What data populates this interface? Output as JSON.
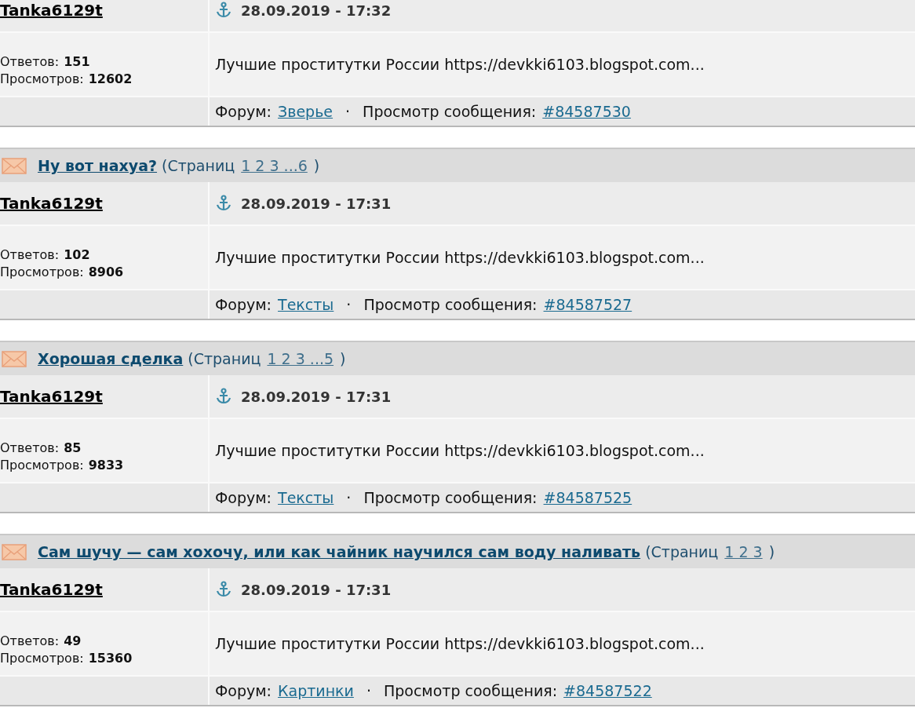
{
  "posts": [
    {
      "author": "Tanka6129t",
      "date": "28.09.2019 - 17:32",
      "replies_label": "Ответов:",
      "replies": "151",
      "views_label": "Просмотров:",
      "views": "12602",
      "text": "Лучшие проститутки России https://devkki6103.blogspot.com...",
      "forum_label": "Форум:",
      "forum": "Зверье",
      "separator": "·",
      "message_label": "Просмотр сообщения:",
      "message_id": "#84587530"
    },
    {
      "title": "Ну вот нахуа?",
      "pages_prefix": "(Страниц",
      "pages": "1 2 3 ...6",
      "pages_suffix": ")",
      "author": "Tanka6129t",
      "date": "28.09.2019 - 17:31",
      "replies_label": "Ответов:",
      "replies": "102",
      "views_label": "Просмотров:",
      "views": "8906",
      "text": "Лучшие проститутки России https://devkki6103.blogspot.com...",
      "forum_label": "Форум:",
      "forum": "Тексты",
      "separator": "·",
      "message_label": "Просмотр сообщения:",
      "message_id": "#84587527"
    },
    {
      "title": "Хорошая сделка",
      "pages_prefix": "(Страниц",
      "pages": "1 2 3 ...5",
      "pages_suffix": ")",
      "author": "Tanka6129t",
      "date": "28.09.2019 - 17:31",
      "replies_label": "Ответов:",
      "replies": "85",
      "views_label": "Просмотров:",
      "views": "9833",
      "text": "Лучшие проститутки России https://devkki6103.blogspot.com...",
      "forum_label": "Форум:",
      "forum": "Тексты",
      "separator": "·",
      "message_label": "Просмотр сообщения:",
      "message_id": "#84587525"
    },
    {
      "title": "Сам шучу — сам хохочу, или как чайник научился сам воду наливать",
      "pages_prefix": "(Страниц",
      "pages": "1 2 3",
      "pages_suffix": ")",
      "author": "Tanka6129t",
      "date": "28.09.2019 - 17:31",
      "replies_label": "Ответов:",
      "replies": "49",
      "views_label": "Просмотров:",
      "views": "15360",
      "text": "Лучшие проститутки России https://devkki6103.blogspot.com...",
      "forum_label": "Форум:",
      "forum": "Картинки",
      "separator": "·",
      "message_label": "Просмотр сообщения:",
      "message_id": "#84587522"
    }
  ]
}
